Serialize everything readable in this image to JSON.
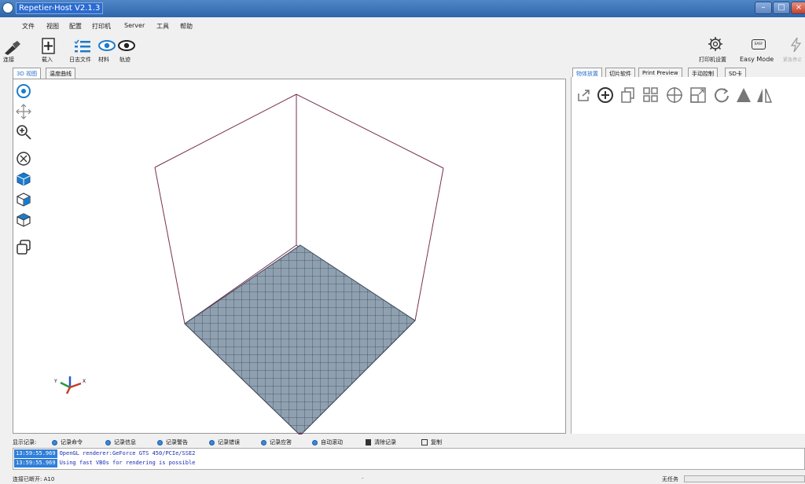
{
  "window": {
    "title": "Repetier-Host V2.1.3",
    "minimize": "–",
    "maximize": "□",
    "close": "×"
  },
  "menu": [
    "文件",
    "视图",
    "配置",
    "打印机",
    "Server",
    "工具",
    "帮助"
  ],
  "toolbar": {
    "connect": "连接",
    "load": "载入",
    "log": "日志文件",
    "material": "材料",
    "track": "轨迹",
    "printer_settings": "打印机设置",
    "easy_mode": "Easy Mode",
    "easy_badge": "EASY",
    "emergency": "紧急停止"
  },
  "tabs_left": [
    "3D 视图",
    "温度曲线"
  ],
  "tabs_right": [
    "物体放置",
    "切片软件",
    "Print Preview",
    "手动控制",
    "SD卡"
  ],
  "log_options": [
    "显示记录:",
    "记录命令",
    "记录信息",
    "记录警告",
    "记录错误",
    "记录应答",
    "自动滚动",
    "清除记录",
    "复制"
  ],
  "log_lines": [
    {
      "time": "13:59:55.969",
      "msg": "OpenGL renderer:GeForce GTS 450/PCIe/SSE2"
    },
    {
      "time": "13:59:55.969",
      "msg": "Using fast VBOs for rendering is possible"
    }
  ],
  "status": {
    "connection": "连接已断开: A10",
    "mid": "-",
    "task": "无任务"
  },
  "colors": {
    "accent": "#2a6fc9",
    "bed": "#8fa0b0",
    "wireframe": "#7a2f52"
  }
}
